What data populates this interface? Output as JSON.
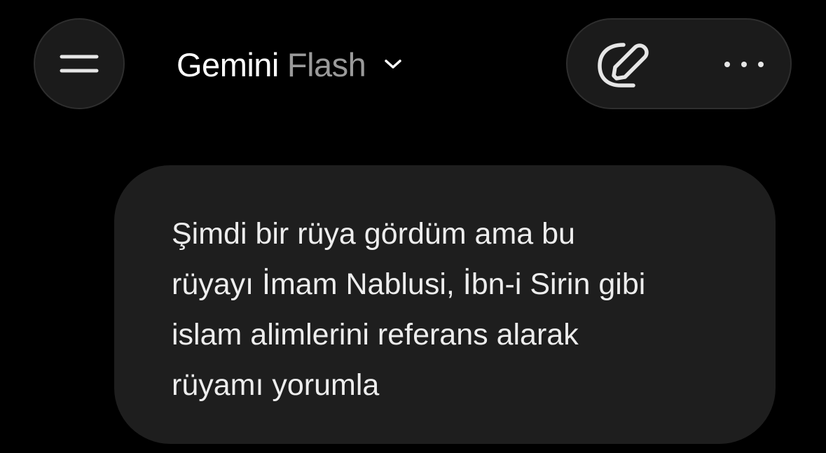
{
  "header": {
    "menu_icon": "hamburger-menu-icon",
    "model_name": "Gemini",
    "model_variant": "Flash",
    "model_dropdown_icon": "chevron-down-icon",
    "edit_icon": "edit-pencil-icon",
    "more_icon": "more-options-icon"
  },
  "conversation": {
    "user_message": " Şimdi bir rüya gördüm ama bu\nrüyayı İmam Nablusi, İbn-i Sirin gibi\nislam alimlerini referans alarak\nrüyamı yorumla"
  },
  "colors": {
    "background": "#000000",
    "surface": "#1b1b1b",
    "bubble": "#1e1e1e",
    "text_primary": "#ffffff",
    "text_secondary": "#9a9a9a"
  }
}
